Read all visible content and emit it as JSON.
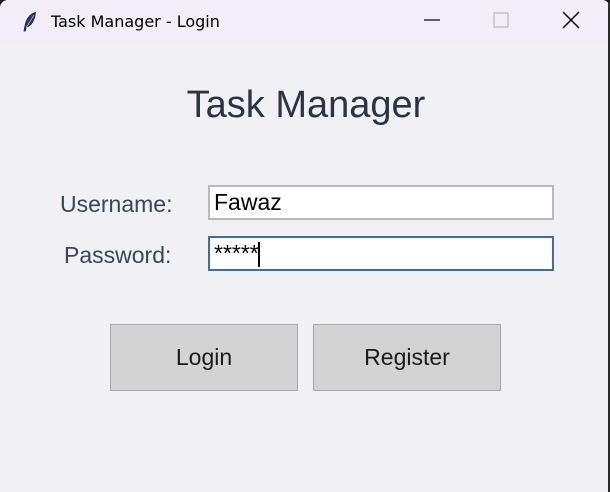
{
  "window": {
    "title": "Task Manager - Login",
    "icon": "feather-icon"
  },
  "titlebar": {
    "minimize": "minimize-icon",
    "maximize": "maximize-icon",
    "close": "close-icon"
  },
  "form": {
    "heading": "Task Manager",
    "username_label": "Username:",
    "username_value": "Fawaz",
    "password_label": "Password:",
    "password_value": "*****"
  },
  "buttons": {
    "login_label": "Login",
    "register_label": "Register"
  },
  "colors": {
    "background": "#f0f0f5",
    "titlebar": "#f3edf7",
    "heading_text": "#2b3443",
    "button_face": "#d3d3d3",
    "focus_border": "#4a6c94"
  }
}
